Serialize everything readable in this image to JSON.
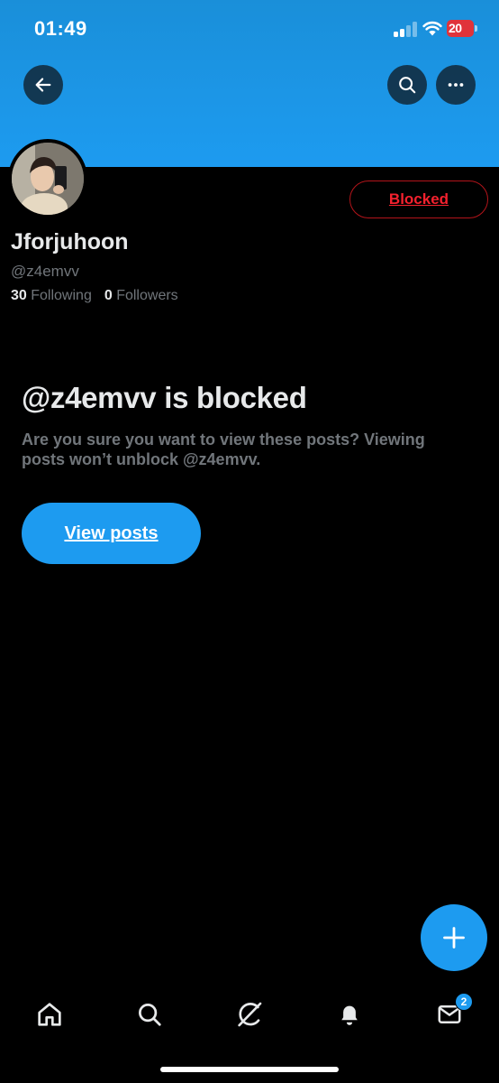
{
  "status_bar": {
    "time": "01:49",
    "battery_level": "20",
    "battery_color": "#e0333a",
    "signal_bars_active": 2,
    "signal_bars_total": 4
  },
  "header": {
    "back_icon": "arrow-left-icon",
    "search_icon": "search-icon",
    "more_icon": "more-horizontal-icon",
    "banner_color": "#1d9bf0"
  },
  "profile": {
    "display_name": "Jforjuhoon",
    "handle": "@z4emvv",
    "following_count": "30",
    "following_label": "Following",
    "followers_count": "0",
    "followers_label": "Followers",
    "blocked_button_label": "Blocked",
    "blocked_color": "#f4212e"
  },
  "blocked_notice": {
    "title": "@z4emvv is blocked",
    "description": "Are you sure you want to view these posts? Viewing posts won’t unblock @z4emvv.",
    "view_posts_label": "View posts"
  },
  "fab": {
    "icon": "plus-icon"
  },
  "tab_bar": {
    "items": [
      {
        "name": "home",
        "icon": "home-icon"
      },
      {
        "name": "search",
        "icon": "search-icon"
      },
      {
        "name": "grok",
        "icon": "grok-icon"
      },
      {
        "name": "notifications",
        "icon": "bell-icon"
      },
      {
        "name": "messages",
        "icon": "mail-icon"
      }
    ],
    "messages_badge": "2"
  },
  "accent_color": "#1d9bf0"
}
